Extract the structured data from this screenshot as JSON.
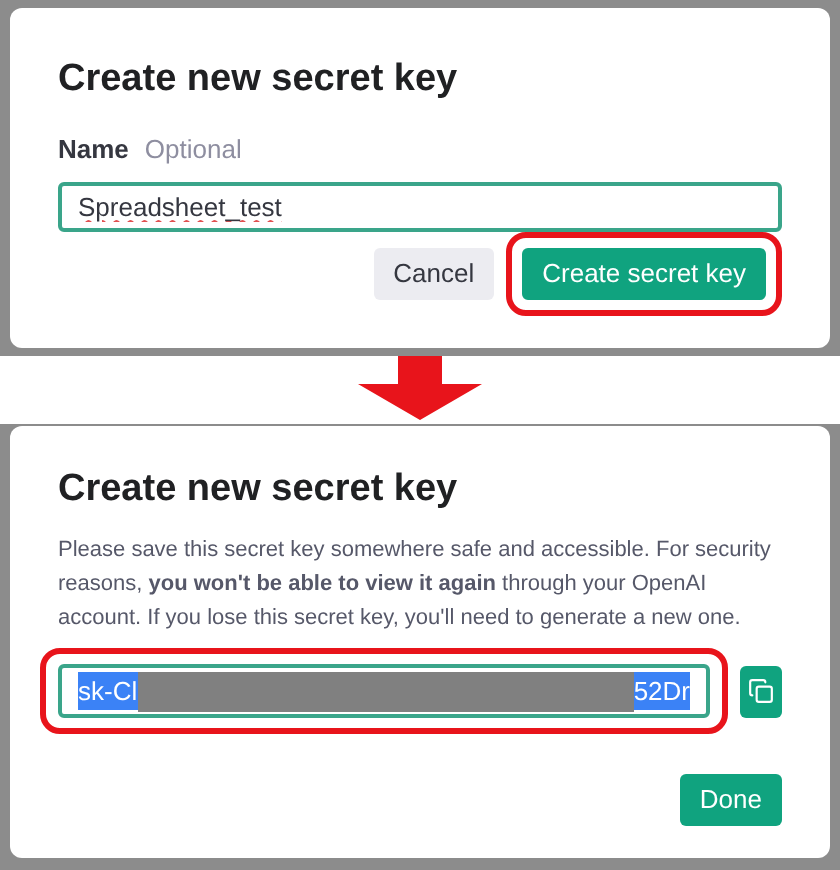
{
  "step_1": {
    "title": "Create new secret key",
    "name_label": "Name",
    "name_hint": "Optional",
    "name_value": "Spreadsheet_test",
    "buttons": [
      {
        "label": "Cancel",
        "kind": "secondary",
        "highlighted": false
      },
      {
        "label": "Create secret key",
        "kind": "primary",
        "highlighted": true
      }
    ]
  },
  "step_2": {
    "title": "Create new secret key",
    "message": "Please save this secret key somewhere safe and accessible. For security reasons, **you won't be able to view it again** through your OpenAI account. If you lose this secret key, you'll need to generate a new one.",
    "key_field": {
      "prefix": "sk-Cl",
      "suffix": "52Dr",
      "selected": true,
      "highlighted": true
    },
    "done_button": "Done"
  }
}
